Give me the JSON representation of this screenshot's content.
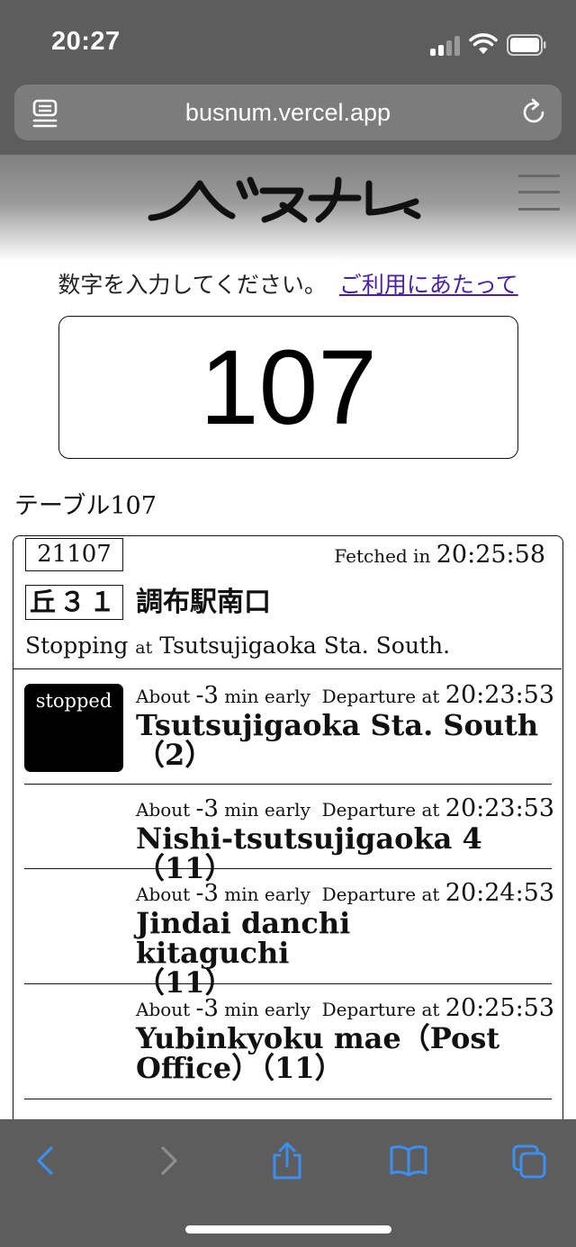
{
  "status_bar": {
    "time": "20:27"
  },
  "browser": {
    "url": "busnum.vercel.app"
  },
  "site": {
    "logo_alt": "バスナム",
    "prompt": "数字を入力してください。",
    "usage_link": "ご利用にあたって",
    "input_value": "107"
  },
  "table_label": "テーブル107",
  "bus": {
    "id": "21107",
    "fetched_prefix": "Fetched in",
    "fetched_time": "20:25:58",
    "route": "丘３１",
    "destination": "調布駅南口",
    "stopping_prefix": "Stopping",
    "stopping_at": "at",
    "stopping_place": "Tsutsujigaoka Sta. South."
  },
  "stops": [
    {
      "about": "About",
      "offset": "-3",
      "offset_unit": "min early",
      "departure_label": "Departure at",
      "time": "20:23:53",
      "name": "Tsutsujigaoka Sta. South（2）",
      "badge": "stopped"
    },
    {
      "about": "About",
      "offset": "-3",
      "offset_unit": "min early",
      "departure_label": "Departure at",
      "time": "20:23:53",
      "name": "Nishi-tsutsujigaoka 4（11）",
      "badge": ""
    },
    {
      "about": "About",
      "offset": "-3",
      "offset_unit": "min early",
      "departure_label": "Departure at",
      "time": "20:24:53",
      "name": "Jindai danchi kitaguchi（11）",
      "badge": ""
    },
    {
      "about": "About",
      "offset": "-3",
      "offset_unit": "min early",
      "departure_label": "Departure at",
      "time": "20:25:53",
      "name": "Yubinkyoku mae（Post Office）（11）",
      "badge": ""
    }
  ],
  "icons": {
    "reader": "reader-icon",
    "reload": "reload-icon",
    "menu": "hamburger-icon",
    "back": "chevron-left-icon",
    "forward": "chevron-right-icon",
    "share": "share-icon",
    "bookmarks": "book-icon",
    "tabs": "tabs-icon"
  },
  "colors": {
    "chrome": "#5d5d5d",
    "url_bar": "#7c7c7c",
    "link": "#4a1fa8",
    "toolbar_active": "#3b8ff0",
    "toolbar_disabled": "#8e8e8e"
  }
}
